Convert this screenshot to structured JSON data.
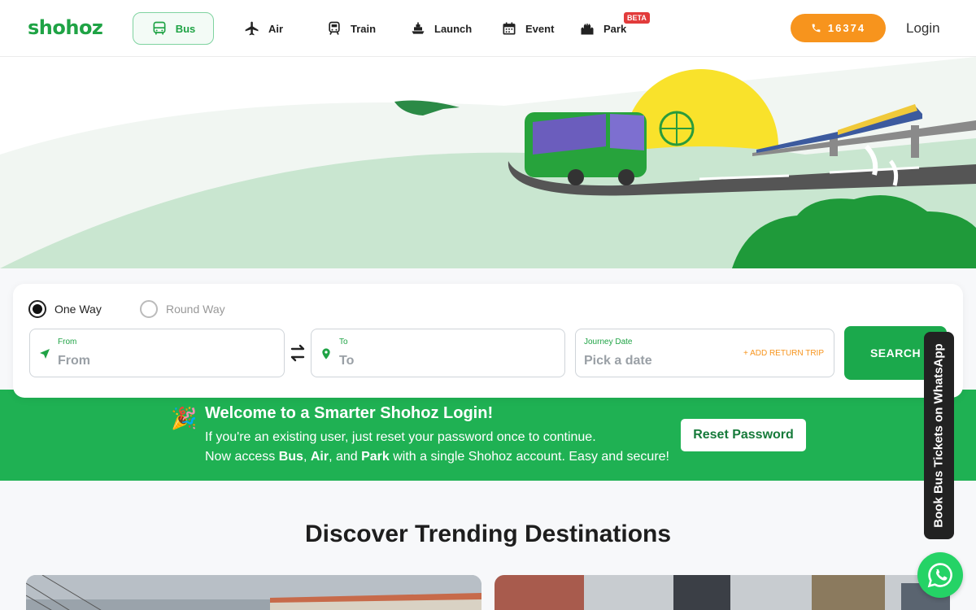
{
  "header": {
    "logo": "shohoz",
    "nav": [
      {
        "label": "Bus",
        "icon": "bus-icon"
      },
      {
        "label": "Air",
        "icon": "plane-icon"
      },
      {
        "label": "Train",
        "icon": "train-icon"
      },
      {
        "label": "Launch",
        "icon": "ship-icon"
      },
      {
        "label": "Event",
        "icon": "calendar-icon"
      },
      {
        "label": "Park",
        "icon": "castle-icon"
      }
    ],
    "park_badge": "BETA",
    "phone": "16374",
    "login": "Login"
  },
  "search": {
    "trip_types": [
      "One Way",
      "Round Way"
    ],
    "from_label": "From",
    "from_placeholder": "From",
    "to_label": "To",
    "to_placeholder": "To",
    "date_label": "Journey Date",
    "date_placeholder": "Pick a date",
    "return_trip": "+ ADD RETURN TRIP",
    "search_button": "SEARCH"
  },
  "banner": {
    "title": "Welcome to a Smarter Shohoz Login!",
    "line1": "If you're an existing user, just reset your password once to continue.",
    "line2_prefix": "Now access ",
    "line2_bus": "Bus",
    "line2_sep1": ", ",
    "line2_air": "Air",
    "line2_sep2": ", and ",
    "line2_park": "Park",
    "line2_suffix": " with a single Shohoz account. Easy and secure!",
    "button": "Reset Password"
  },
  "trending": {
    "title": "Discover Trending Destinations"
  },
  "whatsapp": {
    "tab": "Book Bus Tickets on WhatsApp"
  },
  "colors": {
    "brand_green": "#1fa345",
    "banner_green": "#1fb153",
    "accent_orange": "#f7941d"
  }
}
